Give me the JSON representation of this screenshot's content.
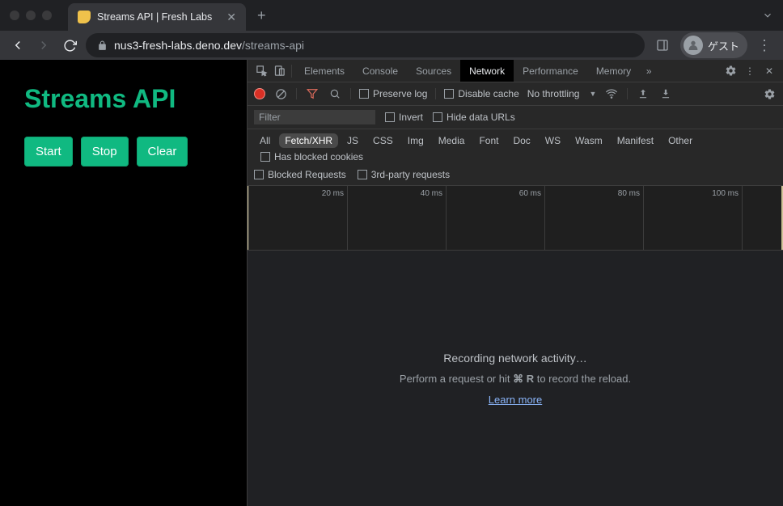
{
  "browser": {
    "tab_title": "Streams API | Fresh Labs",
    "url_host": "nus3-fresh-labs.deno.dev",
    "url_path": "/streams-api",
    "profile_label": "ゲスト"
  },
  "page": {
    "heading": "Streams API",
    "buttons": {
      "start": "Start",
      "stop": "Stop",
      "clear": "Clear"
    }
  },
  "devtools": {
    "tabs": [
      "Elements",
      "Console",
      "Sources",
      "Network",
      "Performance",
      "Memory"
    ],
    "active_tab": "Network",
    "network": {
      "preserve_log": "Preserve log",
      "disable_cache": "Disable cache",
      "throttling": "No throttling",
      "filter_placeholder": "Filter",
      "invert": "Invert",
      "hide_data_urls": "Hide data URLs",
      "types": [
        "All",
        "Fetch/XHR",
        "JS",
        "CSS",
        "Img",
        "Media",
        "Font",
        "Doc",
        "WS",
        "Wasm",
        "Manifest",
        "Other"
      ],
      "active_type": "Fetch/XHR",
      "has_blocked": "Has blocked cookies",
      "blocked_requests": "Blocked Requests",
      "third_party": "3rd-party requests",
      "timeline_labels": [
        "20 ms",
        "40 ms",
        "60 ms",
        "80 ms",
        "100 ms"
      ],
      "empty_title": "Recording network activity…",
      "empty_sub_pre": "Perform a request or hit ",
      "empty_sub_kbd": "⌘ R",
      "empty_sub_post": " to record the reload.",
      "learn_more": "Learn more"
    }
  }
}
